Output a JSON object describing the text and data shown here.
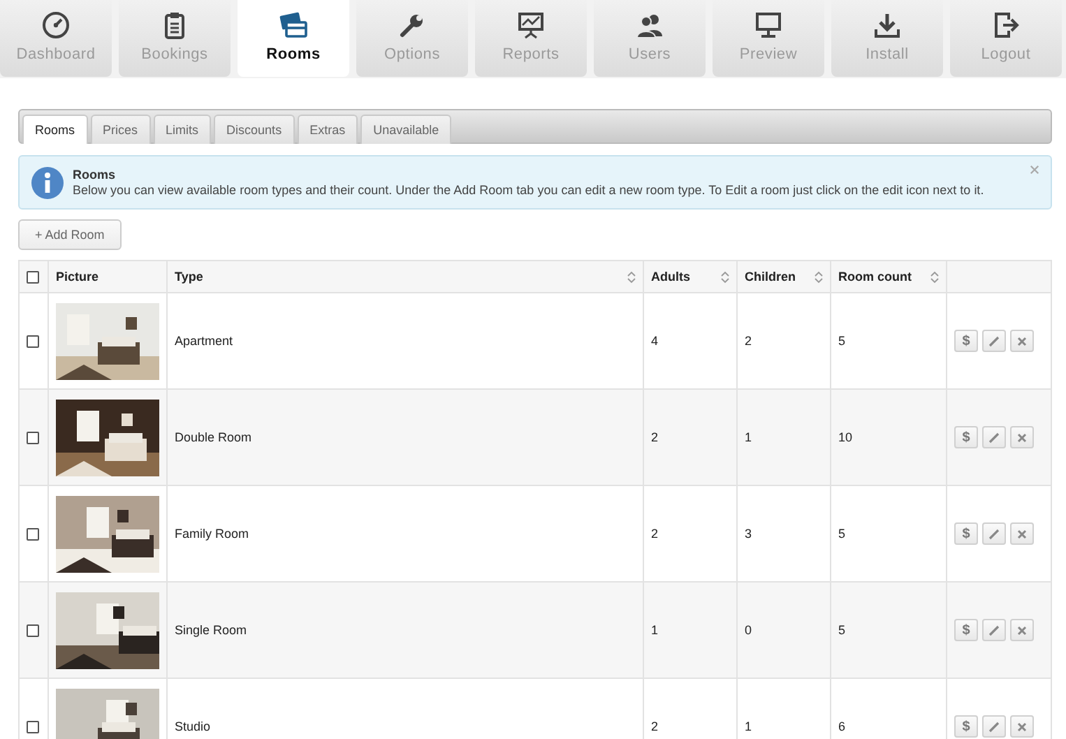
{
  "nav": [
    {
      "label": "Dashboard",
      "selected": false
    },
    {
      "label": "Bookings",
      "selected": false
    },
    {
      "label": "Rooms",
      "selected": true
    },
    {
      "label": "Options",
      "selected": false
    },
    {
      "label": "Reports",
      "selected": false
    },
    {
      "label": "Users",
      "selected": false
    },
    {
      "label": "Preview",
      "selected": false
    },
    {
      "label": "Install",
      "selected": false
    },
    {
      "label": "Logout",
      "selected": false
    }
  ],
  "tabs": [
    {
      "label": "Rooms",
      "selected": true
    },
    {
      "label": "Prices",
      "selected": false
    },
    {
      "label": "Limits",
      "selected": false
    },
    {
      "label": "Discounts",
      "selected": false
    },
    {
      "label": "Extras",
      "selected": false
    },
    {
      "label": "Unavailable",
      "selected": false
    }
  ],
  "notice": {
    "title": "Rooms",
    "text": "Below you can view available room types and their count. Under the Add Room tab you can edit a new room type. To Edit a room just click on the edit icon next to it."
  },
  "add_button": "+ Add Room",
  "table": {
    "select_all": {
      "checked": false
    },
    "columns": [
      {
        "label": "Picture",
        "sortable": false
      },
      {
        "label": "Type",
        "sortable": true
      },
      {
        "label": "Adults",
        "sortable": true
      },
      {
        "label": "Children",
        "sortable": true
      },
      {
        "label": "Room count",
        "sortable": true
      }
    ],
    "rows": [
      {
        "checked": false,
        "type": "Apartment",
        "adults": "4",
        "children": "2",
        "room_count": "5",
        "price_label": "$"
      },
      {
        "checked": false,
        "type": "Double Room",
        "adults": "2",
        "children": "1",
        "room_count": "10",
        "price_label": "$"
      },
      {
        "checked": false,
        "type": "Family Room",
        "adults": "2",
        "children": "3",
        "room_count": "5",
        "price_label": "$"
      },
      {
        "checked": false,
        "type": "Single Room",
        "adults": "1",
        "children": "0",
        "room_count": "5",
        "price_label": "$"
      },
      {
        "checked": false,
        "type": "Studio",
        "adults": "2",
        "children": "1",
        "room_count": "6",
        "price_label": "$"
      }
    ]
  }
}
